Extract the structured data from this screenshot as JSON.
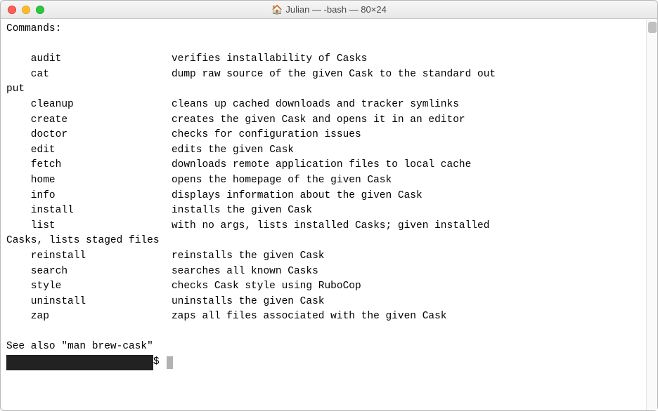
{
  "window": {
    "title": "Julian — -bash — 80×24"
  },
  "terminal": {
    "header": "Commands:",
    "commands": [
      {
        "name": "audit",
        "desc": "verifies installability of Casks"
      },
      {
        "name": "cat",
        "desc": "dump raw source of the given Cask to the standard out",
        "wrap": "put"
      },
      {
        "name": "cleanup",
        "desc": "cleans up cached downloads and tracker symlinks"
      },
      {
        "name": "create",
        "desc": "creates the given Cask and opens it in an editor"
      },
      {
        "name": "doctor",
        "desc": "checks for configuration issues"
      },
      {
        "name": "edit",
        "desc": "edits the given Cask"
      },
      {
        "name": "fetch",
        "desc": "downloads remote application files to local cache"
      },
      {
        "name": "home",
        "desc": "opens the homepage of the given Cask"
      },
      {
        "name": "info",
        "desc": "displays information about the given Cask"
      },
      {
        "name": "install",
        "desc": "installs the given Cask"
      },
      {
        "name": "list",
        "desc": "with no args, lists installed Casks; given installed ",
        "wrap": "Casks, lists staged files"
      },
      {
        "name": "reinstall",
        "desc": "reinstalls the given Cask"
      },
      {
        "name": "search",
        "desc": "searches all known Casks"
      },
      {
        "name": "style",
        "desc": "checks Cask style using RuboCop"
      },
      {
        "name": "uninstall",
        "desc": "uninstalls the given Cask"
      },
      {
        "name": "zap",
        "desc": "zaps all files associated with the given Cask"
      }
    ],
    "footer": "See also \"man brew-cask\"",
    "prompt_redacted": "                        ",
    "prompt_suffix": "$ "
  }
}
